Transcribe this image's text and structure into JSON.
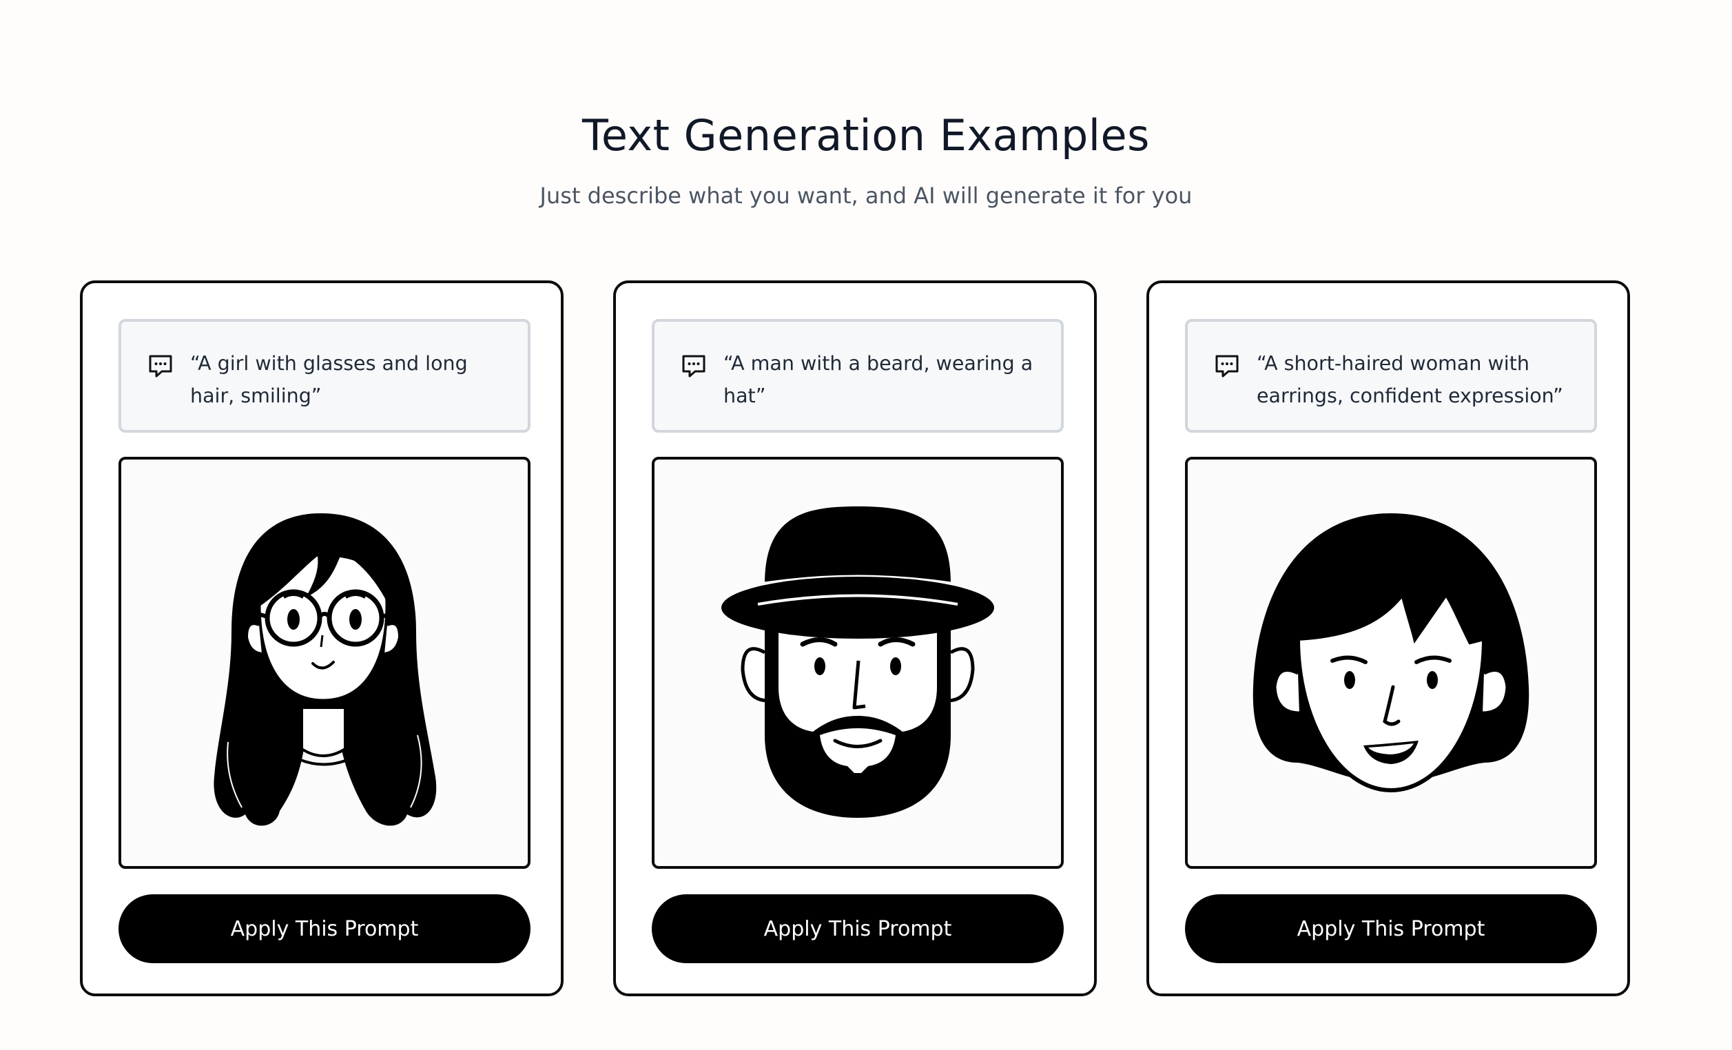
{
  "header": {
    "title": "Text Generation Examples",
    "subtitle": "Just describe what you want, and AI will generate it for you"
  },
  "cards": [
    {
      "prompt": "“A girl with glasses and long hair, smiling”",
      "image_icon": "girl-with-glasses-illustration",
      "button_label": "Apply This Prompt"
    },
    {
      "prompt": "“A man with a beard, wearing a hat”",
      "image_icon": "bearded-man-with-hat-illustration",
      "button_label": "Apply This Prompt"
    },
    {
      "prompt": "“A short-haired woman with earrings, confident expression”",
      "image_icon": "short-haired-woman-with-earrings-illustration",
      "button_label": "Apply This Prompt"
    }
  ],
  "icons": {
    "prompt_icon": "chat-bubble-icon"
  },
  "colors": {
    "background": "#fffdfc",
    "card_border": "#0b0b0b",
    "prompt_background": "#f7f8fa",
    "prompt_border": "#d2d6dd",
    "button_background": "#000000",
    "button_text": "#ffffff",
    "title_text": "#111827",
    "subtitle_text": "#4b5563"
  }
}
